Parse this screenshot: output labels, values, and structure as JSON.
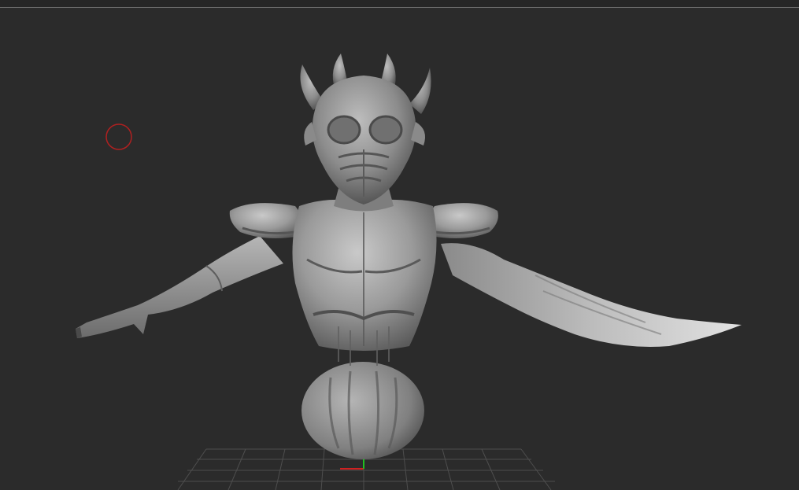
{
  "app": {
    "view": "3d-viewport",
    "background_color": "#2b2b2b"
  },
  "scene": {
    "model": "creature-bust-sculpt",
    "material_color": "#9a9a9a",
    "highlight_color": "#d6d6d6",
    "shadow_color": "#4a4a4a"
  },
  "brush_cursor": {
    "color": "#b02020"
  },
  "floor_grid": {
    "color": "#4e4e4e"
  },
  "axis_gizmo": {
    "x_color": "#d02020",
    "y_color": "#20c020"
  }
}
